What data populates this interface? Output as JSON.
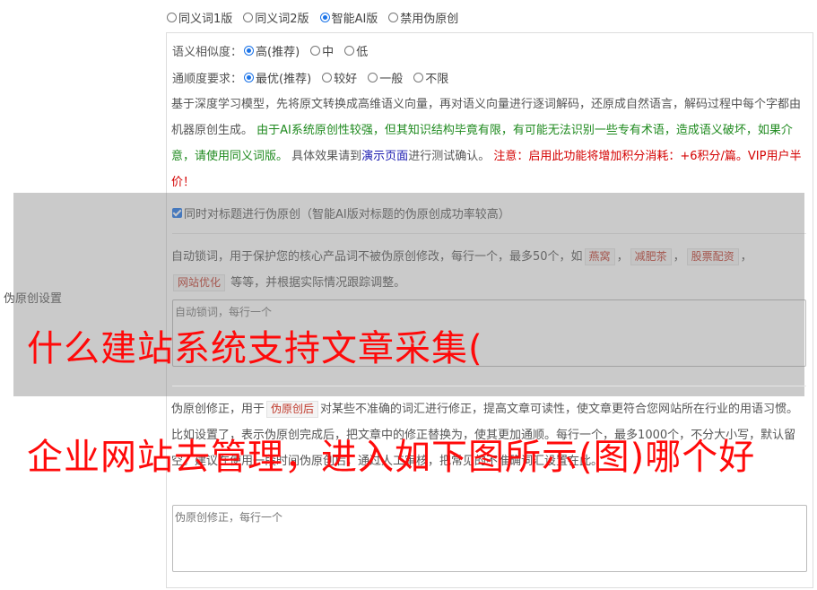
{
  "mode_options": [
    "同义词1版",
    "同义词2版",
    "智能AI版",
    "禁用伪原创"
  ],
  "similarity": {
    "label": "语义相似度：",
    "options": [
      "高(推荐)",
      "中",
      "低"
    ]
  },
  "fluency": {
    "label": "通顺度要求：",
    "options": [
      "最优(推荐)",
      "较好",
      "一般",
      "不限"
    ]
  },
  "description": {
    "part1": "基于深度学习模型，先将原文转换成高维语义向量，再对语义向量进行逐词解码，还原成自然语言，解码过程中每个字都由机器原创生成。",
    "green": "由于AI系统原创性较强，但其知识结构毕竟有限，有可能无法识别一些专有术语，造成语义破坏，如果介意，请使用同义词版。",
    "part2": "具体效果请到",
    "link": "演示页面",
    "part3": "进行测试确认。",
    "red": "注意：启用此功能将增加积分消耗：+6积分/篇。VIP用户半价！"
  },
  "title_checkbox": "同时对标题进行伪原创（智能AI版对标题的伪原创成功率较高）",
  "side_label": "伪原创设置",
  "lock": {
    "text1": "自动锁词，用于保护您的核心产品词不被伪原创修改，每行一个，最多50个，如",
    "tags": [
      "燕窝",
      "减肥茶",
      "股票配资",
      "网站优化"
    ],
    "text2": "等等，并根据实际情况跟踪调整。",
    "placeholder": "自动锁词，每行一个"
  },
  "correction": {
    "text1": "伪原创修正，用于",
    "tag": "伪原创后",
    "text2": "对某些不准确的词汇进行修正，提高文章可读性，使文章更符合您网站所在行业的用语习惯。比如设置了",
    "text3": "，表示伪原创完成后，把文章中的",
    "text4": "修正替换为",
    "text5": "，使其更加通顺。每行一个，最多1000个，不分大小写，默认留空。建议在使用一段时间伪原创后，通过人工审核，把常见的不准确词汇设置在此。",
    "placeholder": "伪原创修正，每行一个"
  },
  "headline1": "什么建站系统支持文章采集(",
  "headline2": "企业网站去管理，进入如下图所示(图)哪个好"
}
